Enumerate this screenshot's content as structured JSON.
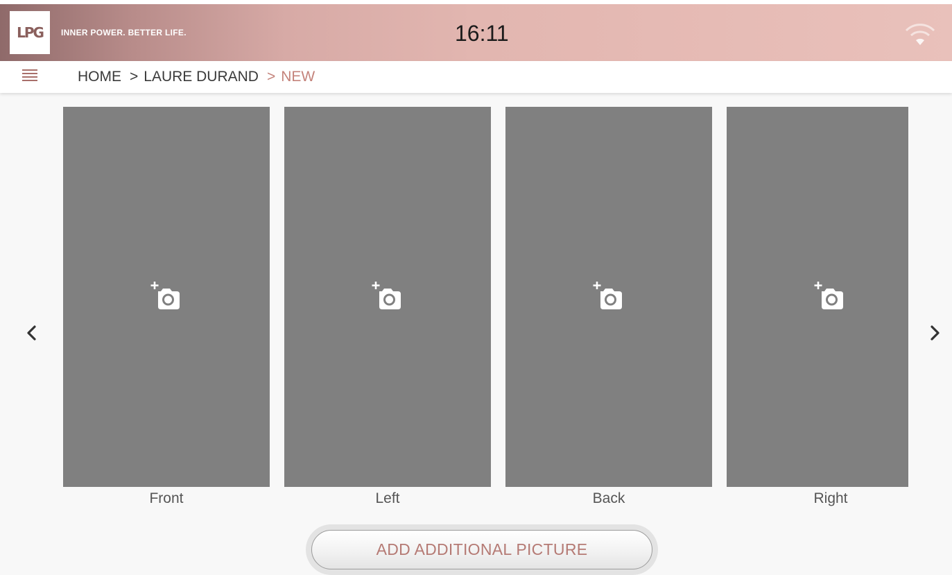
{
  "header": {
    "logo_text": "LPG",
    "tagline": "INNER POWER. BETTER LIFE.",
    "time": "16:11",
    "wifi_icon": "wifi-icon"
  },
  "breadcrumb": {
    "menu_icon": "hamburger-menu-icon",
    "items": [
      "HOME",
      "LAURE DURAND",
      "NEW"
    ],
    "separator": ">"
  },
  "photos": [
    {
      "label": "Front",
      "icon": "add-photo-icon"
    },
    {
      "label": "Left",
      "icon": "add-photo-icon"
    },
    {
      "label": "Back",
      "icon": "add-photo-icon"
    },
    {
      "label": "Right",
      "icon": "add-photo-icon"
    }
  ],
  "nav": {
    "prev_icon": "chevron-left-icon",
    "next_icon": "chevron-right-icon"
  },
  "add_button_label": "ADD ADDITIONAL PICTURE",
  "colors": {
    "accent": "#c4837b",
    "panel": "#808080",
    "header_start": "#8f6a6a",
    "header_end": "#e9c1bb"
  }
}
